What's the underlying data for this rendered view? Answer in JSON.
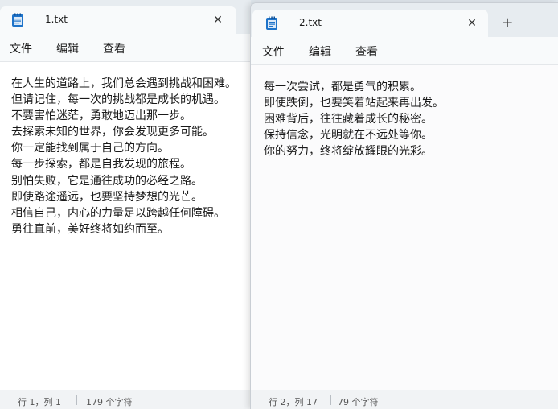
{
  "window1": {
    "tab": {
      "title": "1.txt",
      "close_glyph": "✕",
      "icon": "notepad-icon"
    },
    "menu": [
      "文件",
      "编辑",
      "查看"
    ],
    "lines": [
      "在人生的道路上，我们总会遇到挑战和困难。",
      "但请记住，每一次的挑战都是成长的机遇。",
      "不要害怕迷茫，勇敢地迈出那一步。",
      "去探索未知的世界，你会发现更多可能。",
      "你一定能找到属于自己的方向。",
      "每一步探索，都是自我发现的旅程。",
      "别怕失败，它是通往成功的必经之路。",
      "即使路途遥远，也要坚持梦想的光芒。",
      "相信自己，内心的力量足以跨越任何障碍。",
      "勇往直前，美好终将如约而至。"
    ],
    "status": {
      "position": "行 1，列 1",
      "chars": "179 个字符"
    }
  },
  "window2": {
    "tab": {
      "title": "2.txt",
      "close_glyph": "✕",
      "icon": "notepad-icon"
    },
    "new_tab_glyph": "+",
    "menu": [
      "文件",
      "编辑",
      "查看"
    ],
    "lines": [
      "每一次尝试，都是勇气的积累。",
      "即使跌倒，也要笑着站起来再出发。",
      "困难背后，往往藏着成长的秘密。",
      "保持信念，光明就在不远处等你。",
      "你的努力，终将绽放耀眼的光彩。"
    ],
    "status": {
      "position": "行 2，列 17",
      "chars": "79 个字符"
    }
  },
  "colors": {
    "accent": "#0a66c2",
    "icon_blue": "#1e73c9"
  }
}
